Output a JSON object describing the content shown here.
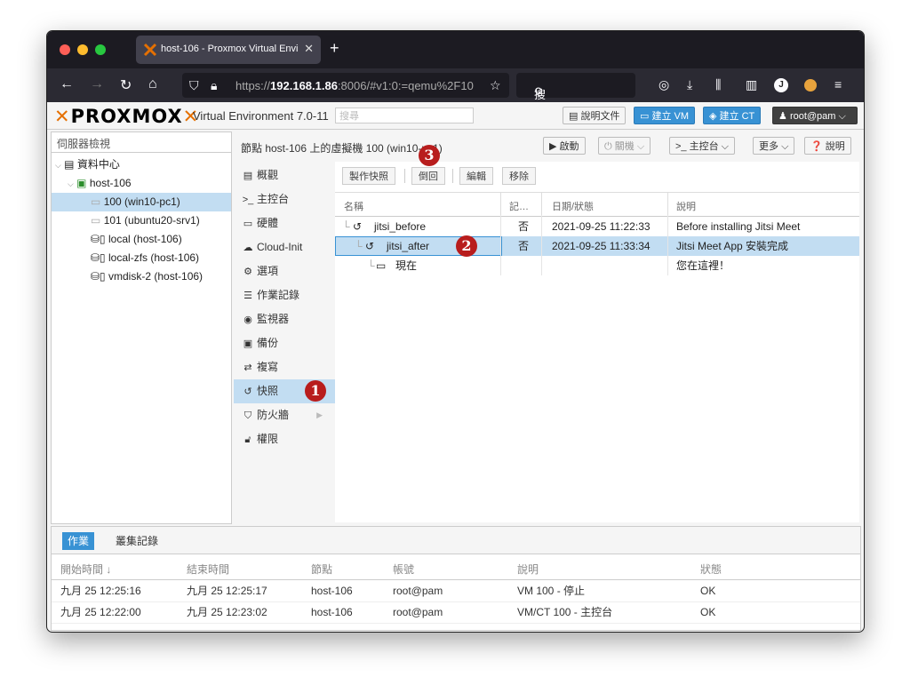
{
  "browser": {
    "tab_title": "host-106 - Proxmox Virtual Envi",
    "new_tab": "+",
    "url_prefix": "https://",
    "url_host": "192.168.1.86",
    "url_rest": ":8006/#v1:0:=qemu%2F10",
    "search_label": "搜尋"
  },
  "header": {
    "logo_text": "PROXMOX",
    "version": "Virtual Environment 7.0-11",
    "search_placeholder": "搜尋",
    "docs": "說明文件",
    "create_vm": "建立 VM",
    "create_ct": "建立 CT",
    "user": "root@pam"
  },
  "tree": {
    "view_label": "伺服器檢視",
    "items": [
      {
        "label": "資料中心"
      },
      {
        "label": "host-106"
      },
      {
        "label": "100 (win10-pc1)"
      },
      {
        "label": "101 (ubuntu20-srv1)"
      },
      {
        "label": "local (host-106)"
      },
      {
        "label": "local-zfs (host-106)"
      },
      {
        "label": "vmdisk-2 (host-106)"
      }
    ]
  },
  "content": {
    "title": "節點 host-106 上的虛擬機 100 (win10-pc1)",
    "start": "啟動",
    "shutdown": "關機",
    "console": "主控台",
    "more": "更多",
    "help": "說明"
  },
  "nav": {
    "items": [
      {
        "label": "概觀"
      },
      {
        "label": "主控台"
      },
      {
        "label": "硬體"
      },
      {
        "label": "Cloud-Init"
      },
      {
        "label": "選項"
      },
      {
        "label": "作業記錄"
      },
      {
        "label": "監視器"
      },
      {
        "label": "備份"
      },
      {
        "label": "複寫"
      },
      {
        "label": "快照"
      },
      {
        "label": "防火牆"
      },
      {
        "label": "權限"
      }
    ]
  },
  "snapshot": {
    "toolbar": {
      "take": "製作快照",
      "rollback": "倒回",
      "edit": "編輯",
      "remove": "移除"
    },
    "columns": [
      "名稱",
      "記…",
      "日期/狀態",
      "說明"
    ],
    "rows": [
      {
        "name": "jitsi_before",
        "ram": "否",
        "date": "2021-09-25 11:22:33",
        "desc": "Before installing Jitsi Meet"
      },
      {
        "name": "jitsi_after",
        "ram": "否",
        "date": "2021-09-25 11:33:34",
        "desc": "Jitsi Meet App 安裝完成"
      },
      {
        "name": "現在",
        "ram": "",
        "date": "",
        "desc": "您在這裡！"
      }
    ]
  },
  "badges": {
    "one": "1",
    "two": "2",
    "three": "3"
  },
  "tasklog": {
    "tabs": [
      "作業",
      "叢集記錄"
    ],
    "columns": [
      "開始時間 ↓",
      "結束時間",
      "節點",
      "帳號",
      "說明",
      "狀態"
    ],
    "rows": [
      {
        "start": "九月 25 12:25:16",
        "end": "九月 25 12:25:17",
        "node": "host-106",
        "user": "root@pam",
        "desc": "VM 100 - 停止",
        "status": "OK"
      },
      {
        "start": "九月 25 12:22:00",
        "end": "九月 25 12:23:02",
        "node": "host-106",
        "user": "root@pam",
        "desc": "VM/CT 100 - 主控台",
        "status": "OK"
      }
    ]
  }
}
